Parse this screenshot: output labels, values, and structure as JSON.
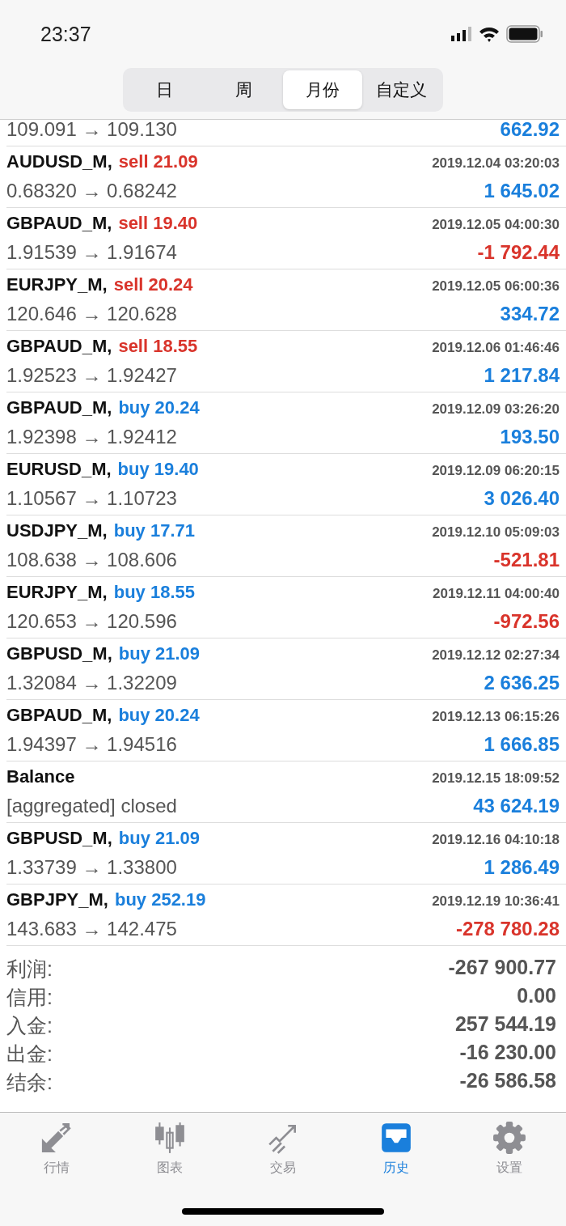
{
  "status_bar": {
    "time": "23:37"
  },
  "period_tabs": [
    {
      "label": "日",
      "selected": false
    },
    {
      "label": "周",
      "selected": false
    },
    {
      "label": "月份",
      "selected": true
    },
    {
      "label": "自定义",
      "selected": false
    }
  ],
  "partial_row": {
    "prices": "109.091 → 109.130",
    "profit": "662.92",
    "loss": false
  },
  "deals": [
    {
      "symbol": "AUDUSD_M,",
      "kind": "sell",
      "volume": "sell 21.09",
      "time": "2019.12.04 03:20:03",
      "prices": "0.68320 → 0.68242",
      "profit": "1 645.02",
      "loss": false
    },
    {
      "symbol": "GBPAUD_M,",
      "kind": "sell",
      "volume": "sell 19.40",
      "time": "2019.12.05 04:00:30",
      "prices": "1.91539 → 1.91674",
      "profit": "-1 792.44",
      "loss": true
    },
    {
      "symbol": "EURJPY_M,",
      "kind": "sell",
      "volume": "sell 20.24",
      "time": "2019.12.05 06:00:36",
      "prices": "120.646 → 120.628",
      "profit": "334.72",
      "loss": false
    },
    {
      "symbol": "GBPAUD_M,",
      "kind": "sell",
      "volume": "sell 18.55",
      "time": "2019.12.06 01:46:46",
      "prices": "1.92523 → 1.92427",
      "profit": "1 217.84",
      "loss": false
    },
    {
      "symbol": "GBPAUD_M,",
      "kind": "buy",
      "volume": "buy 20.24",
      "time": "2019.12.09 03:26:20",
      "prices": "1.92398 → 1.92412",
      "profit": "193.50",
      "loss": false
    },
    {
      "symbol": "EURUSD_M,",
      "kind": "buy",
      "volume": "buy 19.40",
      "time": "2019.12.09 06:20:15",
      "prices": "1.10567 → 1.10723",
      "profit": "3 026.40",
      "loss": false
    },
    {
      "symbol": "USDJPY_M,",
      "kind": "buy",
      "volume": "buy 17.71",
      "time": "2019.12.10 05:09:03",
      "prices": "108.638 → 108.606",
      "profit": "-521.81",
      "loss": true
    },
    {
      "symbol": "EURJPY_M,",
      "kind": "buy",
      "volume": "buy 18.55",
      "time": "2019.12.11 04:00:40",
      "prices": "120.653 → 120.596",
      "profit": "-972.56",
      "loss": true
    },
    {
      "symbol": "GBPUSD_M,",
      "kind": "buy",
      "volume": "buy 21.09",
      "time": "2019.12.12 02:27:34",
      "prices": "1.32084 → 1.32209",
      "profit": "2 636.25",
      "loss": false
    },
    {
      "symbol": "GBPAUD_M,",
      "kind": "buy",
      "volume": "buy 20.24",
      "time": "2019.12.13 06:15:26",
      "prices": "1.94397 → 1.94516",
      "profit": "1 666.85",
      "loss": false
    },
    {
      "symbol": "Balance",
      "time": "2019.12.15 18:09:52",
      "prices": "[aggregated] closed",
      "profit": "43 624.19",
      "loss": false
    },
    {
      "symbol": "GBPUSD_M,",
      "kind": "buy",
      "volume": "buy 21.09",
      "time": "2019.12.16 04:10:18",
      "prices": "1.33739 → 1.33800",
      "profit": "1 286.49",
      "loss": false
    },
    {
      "symbol": "GBPJPY_M,",
      "kind": "buy",
      "volume": "buy 252.19",
      "time": "2019.12.19 10:36:41",
      "prices": "143.683 → 142.475",
      "profit": "-278 780.28",
      "loss": true
    }
  ],
  "summary": [
    {
      "label": "利润:",
      "value": "-267 900.77"
    },
    {
      "label": "信用:",
      "value": "0.00"
    },
    {
      "label": "入金:",
      "value": "257 544.19"
    },
    {
      "label": "出金:",
      "value": "-16 230.00"
    },
    {
      "label": "结余:",
      "value": "-26 586.58"
    }
  ],
  "tab_bar": [
    {
      "kind": "quotes",
      "label": "行情",
      "selected": false
    },
    {
      "kind": "chart",
      "label": "图表",
      "selected": false
    },
    {
      "kind": "trade",
      "label": "交易",
      "selected": false
    },
    {
      "kind": "history",
      "label": "历史",
      "selected": true
    },
    {
      "kind": "settings",
      "label": "设置",
      "selected": false
    }
  ]
}
